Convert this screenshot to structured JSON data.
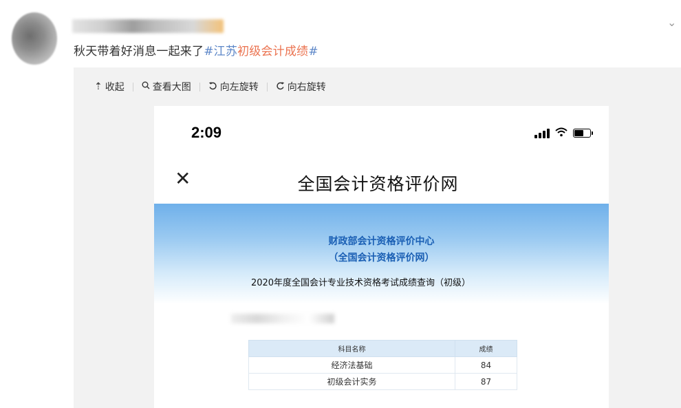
{
  "post": {
    "text_prefix": "秋天带着好消息一起来了",
    "topic_hash_open": "#",
    "topic_jiangsu": "江苏",
    "topic_rest": "初级会计成绩",
    "topic_hash_close": "#"
  },
  "toolbar": {
    "collapse_label": "收起",
    "view_large_label": "查看大图",
    "rotate_left_label": "向左旋转",
    "rotate_right_label": "向右旋转"
  },
  "phone": {
    "time": "2:09",
    "nav_title": "全国会计资格评价网",
    "org_line_1": "财政部会计资格评价中心",
    "org_line_2": "（全国会计资格评价网）",
    "query_title": "2020年度全国会计专业技术资格考试成绩查询（初级）",
    "table": {
      "headers": [
        "科目名称",
        "成绩"
      ],
      "rows": [
        {
          "subject": "经济法基础",
          "score": "84"
        },
        {
          "subject": "初级会计实务",
          "score": "87"
        }
      ]
    }
  },
  "icons": {
    "collapse": "arrow-up-icon",
    "view_large": "magnifier-icon",
    "rotate_left": "rotate-left-icon",
    "rotate_right": "rotate-right-icon",
    "expand": "chevron-down-icon",
    "close": "close-icon"
  },
  "colors": {
    "topic_link": "#eb7350",
    "topic_hash": "#5d87c8",
    "banner_text": "#1a5fb4",
    "panel_bg": "#f2f2f2"
  }
}
